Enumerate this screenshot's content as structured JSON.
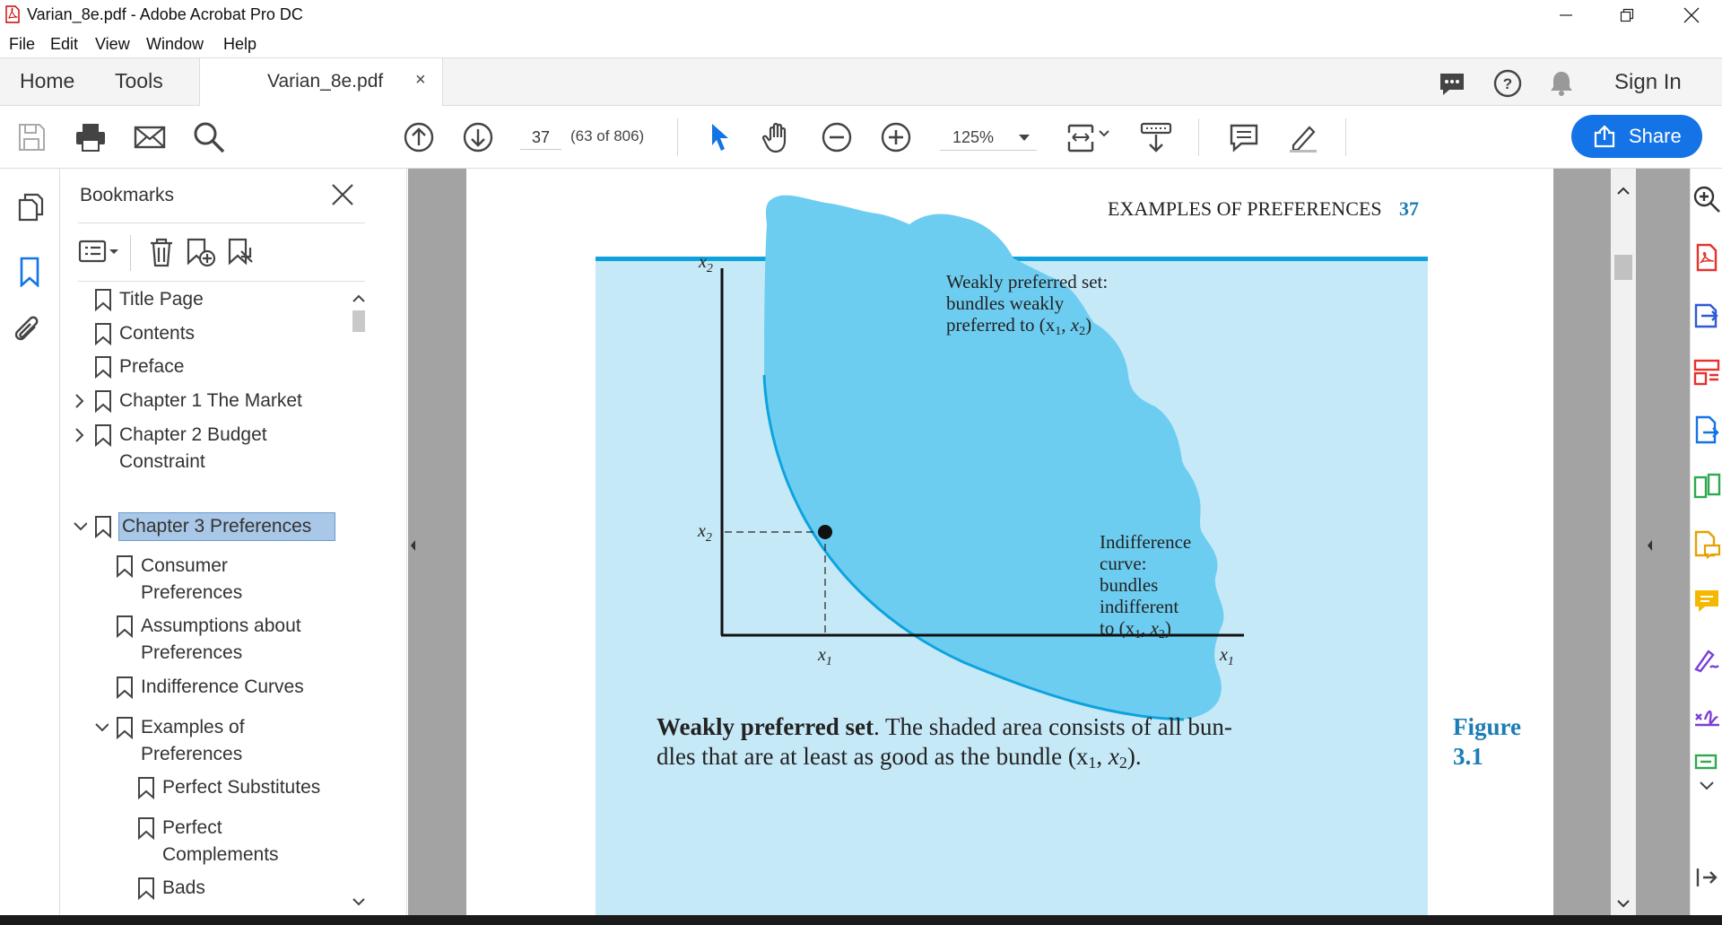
{
  "window": {
    "title": "Varian_8e.pdf - Adobe Acrobat Pro DC",
    "icon": "acrobat-pdf-icon"
  },
  "menu": [
    "File",
    "Edit",
    "View",
    "Window",
    "Help"
  ],
  "tabs": {
    "home": "Home",
    "tools": "Tools",
    "document": "Varian_8e.pdf",
    "close": "×",
    "sign_in": "Sign In"
  },
  "toolbar": {
    "page_number": "37",
    "page_count": "(63 of 806)",
    "zoom": "125%",
    "share_label": "Share"
  },
  "bookmarks": {
    "title": "Bookmarks",
    "items": [
      {
        "label": "Title Page",
        "level": 0,
        "expand": ""
      },
      {
        "label": "Contents",
        "level": 0,
        "expand": ""
      },
      {
        "label": "Preface",
        "level": 0,
        "expand": ""
      },
      {
        "label": "Chapter 1 The Market",
        "level": 0,
        "expand": "collapsed"
      },
      {
        "label": "Chapter 2 Budget",
        "label2": "Constraint",
        "level": 0,
        "expand": "collapsed"
      },
      {
        "label": "Chapter 3 Preferences",
        "level": 0,
        "expand": "expanded",
        "selected": true
      },
      {
        "label": "Consumer",
        "label2": "Preferences",
        "level": 1,
        "expand": ""
      },
      {
        "label": "Assumptions about",
        "label2": "Preferences",
        "level": 1,
        "expand": ""
      },
      {
        "label": "Indifference Curves",
        "level": 1,
        "expand": ""
      },
      {
        "label": "Examples of",
        "label2": "Preferences",
        "level": 1,
        "expand": "expanded"
      },
      {
        "label": "Perfect Substitutes",
        "level": 2,
        "expand": ""
      },
      {
        "label": "Perfect",
        "label2": "Complements",
        "level": 2,
        "expand": ""
      },
      {
        "label": "Bads",
        "level": 2,
        "expand": ""
      }
    ]
  },
  "document": {
    "running_head": "EXAMPLES OF PREFERENCES",
    "page_number": "37",
    "figure": {
      "y_axis": "x",
      "y_sub": "2",
      "x_axis": "x",
      "x_sub": "1",
      "tick_x": "x",
      "tick_x_sub": "1",
      "tick_y": "x",
      "tick_y_sub": "2",
      "label_preferred_1": "Weakly preferred set:",
      "label_preferred_2": "bundles weakly",
      "label_preferred_3": "preferred to (x",
      "label_indiff_1": "Indifference",
      "label_indiff_2": "curve:",
      "label_indiff_3": "bundles",
      "label_indiff_4": "indifferent",
      "label_indiff_5": "to (x",
      "fill_color": "#6dcdf1",
      "panel_color": "#c6e9f8",
      "curve_color": "#0ea3de"
    },
    "caption_bold": "Weakly preferred set",
    "caption_text": ". The shaded area consists of all bun-",
    "caption_line2": "dles that are at least as good as the bundle (x",
    "figure_label": "Figure",
    "figure_number": "3.1"
  }
}
